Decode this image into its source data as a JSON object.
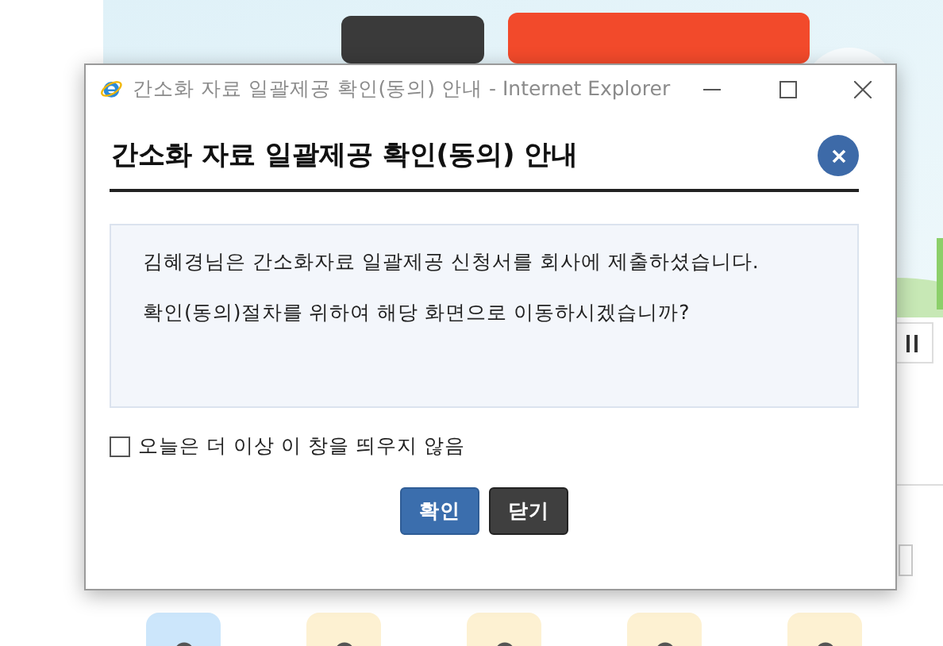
{
  "window": {
    "title": "간소화 자료 일괄제공 확인(동의) 안내 - Internet Explorer"
  },
  "dialog": {
    "heading": "간소화 자료 일괄제공 확인(동의) 안내",
    "message": [
      "김혜경님은 간소화자료 일괄제공 신청서를 회사에 제출하셨습니다.",
      "확인(동의)절차를 위하여 해당 화면으로 이동하시겠습니까?"
    ],
    "option": {
      "label": "오늘은 더 이상 이 창을 띄우지 않음",
      "checked": false
    },
    "buttons": [
      {
        "label": "확인",
        "kind": "primary"
      },
      {
        "label": "닫기",
        "kind": "dark"
      }
    ]
  },
  "background": {
    "tiles": [
      {
        "color": "#cce6fb"
      },
      {
        "color": "#fdf1d2"
      },
      {
        "color": "#fdf1d2"
      },
      {
        "color": "#fdf1d2"
      },
      {
        "color": "#fdf1d2"
      }
    ]
  }
}
